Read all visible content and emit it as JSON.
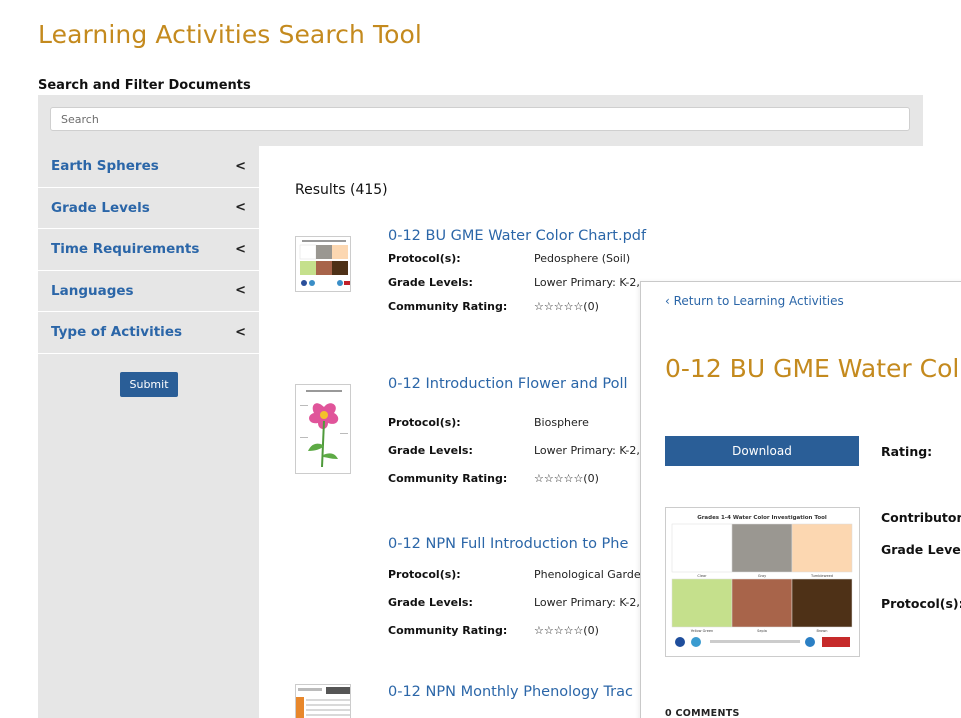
{
  "page_title": "Learning Activities Search Tool",
  "section_title": "Search and Filter Documents",
  "search": {
    "placeholder": "Search"
  },
  "filters": [
    {
      "label": "Earth Spheres",
      "chevron": "<"
    },
    {
      "label": "Grade Levels",
      "chevron": "<"
    },
    {
      "label": "Time Requirements",
      "chevron": "<"
    },
    {
      "label": "Languages",
      "chevron": "<"
    },
    {
      "label": "Type of Activities",
      "chevron": "<"
    }
  ],
  "submit_label": "Submit",
  "results_title": "Results (415)",
  "meta_keys": {
    "protocols": "Protocol(s):",
    "grade_levels": "Grade Levels:",
    "community_rating": "Community Rating:"
  },
  "results": [
    {
      "title": "0-12 BU GME Water Color Chart.pdf",
      "protocols": "Pedosphere (Soil)",
      "grade_levels": "Lower Primary: K-2,",
      "rating": "☆☆☆☆☆(0)"
    },
    {
      "title": "0-12 Introduction Flower and Poll",
      "protocols": "Biosphere",
      "grade_levels": "Lower Primary: K-2,",
      "rating": "☆☆☆☆☆(0)"
    },
    {
      "title": "0-12 NPN Full Introduction to Phe",
      "protocols": "Phenological Garder",
      "grade_levels": "Lower Primary: K-2,",
      "rating": "☆☆☆☆☆(0)"
    },
    {
      "title": "0-12 NPN Monthly Phenology Trac"
    }
  ],
  "detail": {
    "back_label": "Return to Learning Activities",
    "title": "0-12 BU GME Water Col",
    "download_label": "Download",
    "rating_label": "Rating:",
    "contributor_label": "Contributor",
    "grade_level_label": "Grade Level",
    "protocols_label": "Protocol(s):",
    "comments_label": "0 COMMENTS",
    "preview": {
      "title": "Grades 1-4 Water Color Investigation Tool",
      "swatches": [
        {
          "name": "Clear",
          "color": "#ffffff"
        },
        {
          "name": "Gray",
          "color": "#9a9791"
        },
        {
          "name": "Tumbleweed",
          "color": "#fcd7b1"
        },
        {
          "name": "Yellow Green",
          "color": "#c5e08c"
        },
        {
          "name": "Sepia",
          "color": "#a8644a"
        },
        {
          "name": "Brown",
          "color": "#4e3117"
        }
      ]
    }
  },
  "colors": {
    "accent": "#c48a1e",
    "link": "#2b66a8",
    "button": "#2a5e97",
    "panel": "#e6e6e6"
  }
}
